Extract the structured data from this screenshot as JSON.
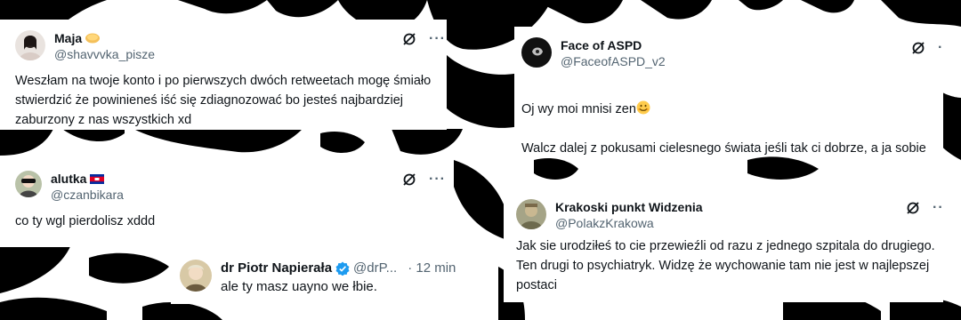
{
  "tweets": [
    {
      "name": "Maja",
      "handle": "@shavvvka_pisze",
      "text": "Weszłam na twoje konto i po pierwszych dwóch retweetach mogę śmiało\nstwierdzić że powinieneś iść się zdiagnozować bo jesteś najbardziej\nzaburzony z nas wszystkich xd",
      "more_label": "···"
    },
    {
      "name": "Face of ASPD",
      "handle": "@FaceofASPD_v2",
      "text_line1": "Oj wy moi mnisi zen",
      "text_rest": "Walcz dalej z pokusami cielesnego świata jeśli tak ci dobrze, a ja sobie tę\nrozmowę zapamiętam bo serio jest to najdziwniejsza racjonalizacja\nwłasnego społecznego nieogarnięcia jaką pamiętam na tym portalu",
      "more_label": "···"
    },
    {
      "name": "alutka",
      "handle": "@czanbikara",
      "text": "co ty wgl pierdolisz xddd",
      "more_label": "···"
    },
    {
      "name": "dr Piotr Napierała",
      "handle": "@drP...",
      "time": "· 12 min",
      "text": "ale ty masz uayno we łbie."
    },
    {
      "name": "Krakoski punkt Widzenia",
      "handle": "@PolakzKrakowa",
      "text": "Jak sie urodziłeś to cie przewieźli od razu z jednego szpitala do drugiego.\nTen drugi to psychiatryk. Widzę że wychowanie tam nie jest w najlepszej\npostaci",
      "more_label": "···"
    }
  ],
  "colors": {
    "handle": "#536471",
    "verified": "#1d9bf0",
    "text": "#0f1419"
  }
}
